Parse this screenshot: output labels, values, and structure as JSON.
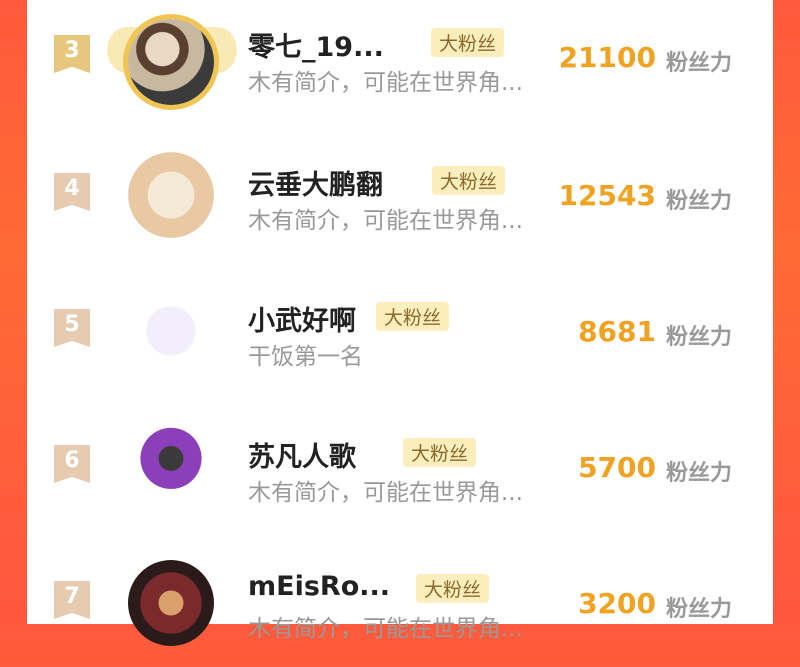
{
  "ranking": {
    "unit_label": "粉丝力",
    "rows": [
      {
        "rank": "3",
        "name": "零七_19...",
        "badge": "大粉丝",
        "desc": "木有简介，可能在世界角...",
        "score": "21100"
      },
      {
        "rank": "4",
        "name": "云垂大鹏翻",
        "badge": "大粉丝",
        "desc": "木有简介，可能在世界角...",
        "score": "12543"
      },
      {
        "rank": "5",
        "name": "小武好啊",
        "badge": "大粉丝",
        "desc": "干饭第一名",
        "score": "8681"
      },
      {
        "rank": "6",
        "name": "苏凡人歌",
        "badge": "大粉丝",
        "desc": "木有简介，可能在世界角...",
        "score": "5700"
      },
      {
        "rank": "7",
        "name": "mEisRo...",
        "badge": "大粉丝",
        "desc": "木有简介，可能在世界角...",
        "score": "3200"
      }
    ]
  },
  "colors": {
    "accent": "#f0a322",
    "rank_gold": "#e7c77e",
    "rank_default": "#e6cbb0",
    "background": "#ff5a3c"
  }
}
